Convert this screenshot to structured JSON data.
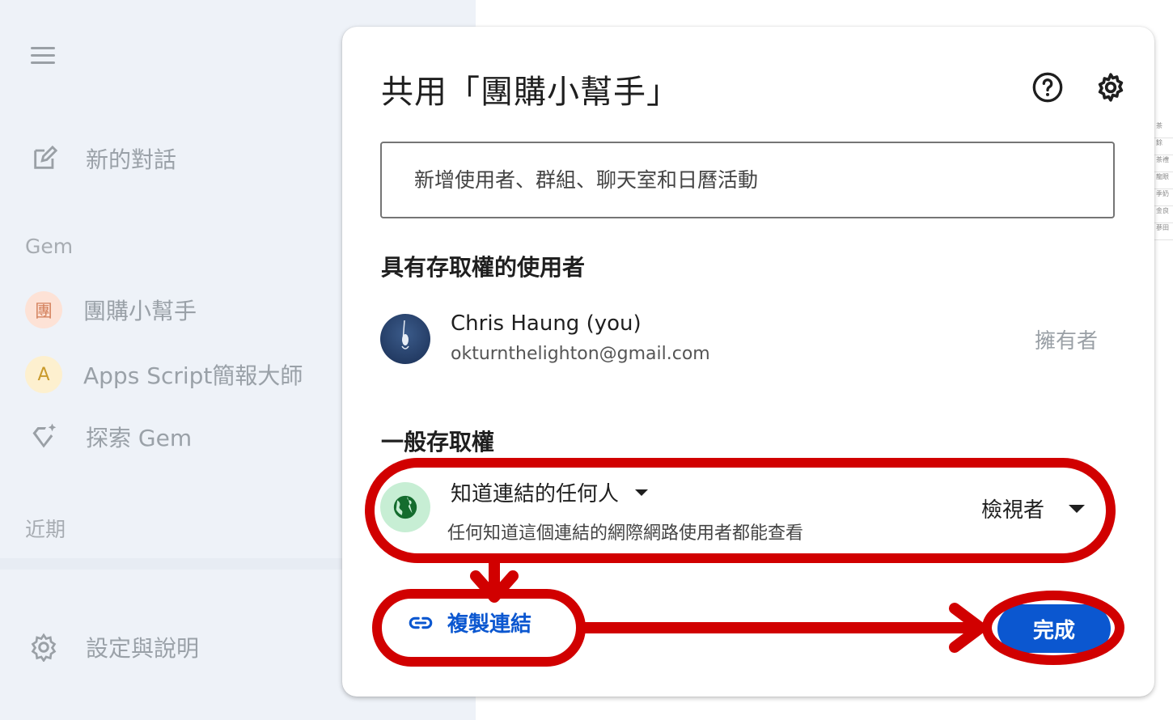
{
  "sidebar": {
    "new_chat_label": "新的對話",
    "gem_section_label": "Gem",
    "gems": [
      {
        "initial": "團",
        "label": "團購小幫手",
        "avatar_bg": "#fde2d6",
        "avatar_fg": "#d4825e"
      },
      {
        "initial": "A",
        "label": "Apps Script簡報大師",
        "avatar_bg": "#fdf0cf",
        "avatar_fg": "#c99a2b"
      }
    ],
    "explore_label": "探索 Gem",
    "recent_section_label": "近期",
    "settings_label": "設定與說明"
  },
  "dialog": {
    "title": "共用「團購小幫手」",
    "add_people_placeholder": "新增使用者、群組、聊天室和日曆活動",
    "people_section_title": "具有存取權的使用者",
    "user": {
      "name": "Chris Haung (you)",
      "email": "okturnthelighton@gmail.com",
      "role": "擁有者"
    },
    "general_access_title": "一般存取權",
    "access_level": "知道連結的任何人",
    "access_description": "任何知道這個連結的網際網路使用者都能查看",
    "access_role": "檢視者",
    "copy_link_label": "複製連結",
    "done_label": "完成"
  },
  "background_cells": [
    "茶",
    "餘",
    "茶禮",
    "龍眼",
    "季奶",
    "金良",
    "蔘田"
  ],
  "colors": {
    "accent_blue": "#0b57d0",
    "annotation_red": "#d10000",
    "globe_green": "#146c2e"
  }
}
